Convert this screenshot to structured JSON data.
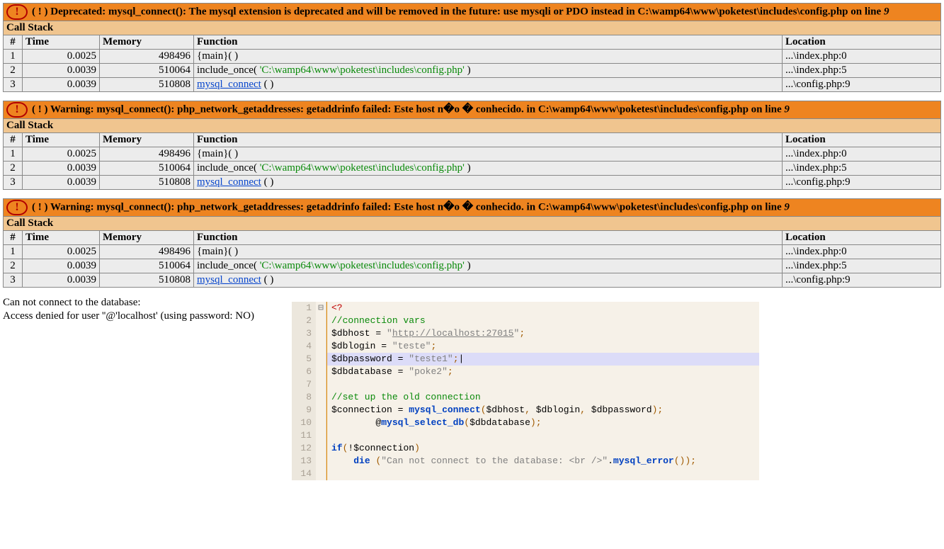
{
  "columns": {
    "idx": "#",
    "time": "Time",
    "memory": "Memory",
    "function": "Function",
    "location": "Location"
  },
  "callstack_label": "Call Stack",
  "errors": [
    {
      "kind": "Deprecated",
      "msg": "mysql_connect(): The mysql extension is deprecated and will be removed in the future: use mysqli or PDO instead in C:\\wamp64\\www\\poketest\\includes\\config.php on line",
      "line": "9",
      "stack": [
        {
          "idx": "1",
          "time": "0.0025",
          "mem": "498496",
          "func_pre": "{main}( )",
          "path": "",
          "func_post": "",
          "link": "",
          "loc": "...\\index.php:0"
        },
        {
          "idx": "2",
          "time": "0.0039",
          "mem": "510064",
          "func_pre": "include_once( ",
          "path": "'C:\\wamp64\\www\\poketest\\includes\\config.php'",
          "func_post": " )",
          "link": "",
          "loc": "...\\index.php:5"
        },
        {
          "idx": "3",
          "time": "0.0039",
          "mem": "510808",
          "func_pre": "",
          "path": "",
          "func_post": " ( )",
          "link": "mysql_connect",
          "loc": "...\\config.php:9"
        }
      ]
    },
    {
      "kind": "Warning",
      "msg": "mysql_connect(): php_network_getaddresses: getaddrinfo failed: Este host n�o � conhecido. in C:\\wamp64\\www\\poketest\\includes\\config.php on line",
      "line": "9",
      "stack": [
        {
          "idx": "1",
          "time": "0.0025",
          "mem": "498496",
          "func_pre": "{main}( )",
          "path": "",
          "func_post": "",
          "link": "",
          "loc": "...\\index.php:0"
        },
        {
          "idx": "2",
          "time": "0.0039",
          "mem": "510064",
          "func_pre": "include_once( ",
          "path": "'C:\\wamp64\\www\\poketest\\includes\\config.php'",
          "func_post": " )",
          "link": "",
          "loc": "...\\index.php:5"
        },
        {
          "idx": "3",
          "time": "0.0039",
          "mem": "510808",
          "func_pre": "",
          "path": "",
          "func_post": " ( )",
          "link": "mysql_connect",
          "loc": "...\\config.php:9"
        }
      ]
    },
    {
      "kind": "Warning",
      "msg": "mysql_connect(): php_network_getaddresses: getaddrinfo failed: Este host n�o � conhecido. in C:\\wamp64\\www\\poketest\\includes\\config.php on line",
      "line": "9",
      "stack": [
        {
          "idx": "1",
          "time": "0.0025",
          "mem": "498496",
          "func_pre": "{main}( )",
          "path": "",
          "func_post": "",
          "link": "",
          "loc": "...\\index.php:0"
        },
        {
          "idx": "2",
          "time": "0.0039",
          "mem": "510064",
          "func_pre": "include_once( ",
          "path": "'C:\\wamp64\\www\\poketest\\includes\\config.php'",
          "func_post": " )",
          "link": "",
          "loc": "...\\index.php:5"
        },
        {
          "idx": "3",
          "time": "0.0039",
          "mem": "510808",
          "func_pre": "",
          "path": "",
          "func_post": " ( )",
          "link": "mysql_connect",
          "loc": "...\\config.php:9"
        }
      ]
    }
  ],
  "plain": {
    "line1": "Can not connect to the database:",
    "line2": "Access denied for user ''@'localhost' (using password: NO)"
  },
  "editor": {
    "lines": [
      {
        "n": "1",
        "fold": "⊟",
        "hl": false,
        "html": "<span class='tok-open'>&lt;?</span>"
      },
      {
        "n": "2",
        "fold": "",
        "hl": false,
        "html": "<span class='tok-cmt'>//connection vars</span>"
      },
      {
        "n": "3",
        "fold": "",
        "hl": false,
        "html": "<span class='tok-var'>$dbhost</span> <span class='tok-op'>=</span> <span class='tok-strp'>\"</span><span class='tok-str'>http://localhost:27015</span><span class='tok-strp'>\"</span><span class='tok-punc'>;</span>"
      },
      {
        "n": "4",
        "fold": "",
        "hl": false,
        "html": "<span class='tok-var'>$dblogin</span> <span class='tok-op'>=</span> <span class='tok-strp'>\"teste\"</span><span class='tok-punc'>;</span>"
      },
      {
        "n": "5",
        "fold": "",
        "hl": true,
        "html": "<span class='tok-var'>$dbpassword</span> <span class='tok-op'>=</span> <span class='tok-strp'>\"teste1\"</span><span class='tok-punc'>;</span>|"
      },
      {
        "n": "6",
        "fold": "",
        "hl": false,
        "html": "<span class='tok-var'>$dbdatabase</span> <span class='tok-op'>=</span> <span class='tok-strp'>\"poke2\"</span><span class='tok-punc'>;</span>"
      },
      {
        "n": "7",
        "fold": "",
        "hl": false,
        "html": " "
      },
      {
        "n": "8",
        "fold": "",
        "hl": false,
        "html": "<span class='tok-cmt'>//set up the old connection</span>"
      },
      {
        "n": "9",
        "fold": "",
        "hl": false,
        "html": "<span class='tok-var'>$connection</span> <span class='tok-op'>=</span> <span class='tok-kw'>mysql_connect</span><span class='tok-punc'>(</span><span class='tok-var'>$dbhost</span><span class='tok-punc'>,</span> <span class='tok-var'>$dblogin</span><span class='tok-punc'>,</span> <span class='tok-var'>$dbpassword</span><span class='tok-punc'>)</span><span class='tok-punc'>;</span>"
      },
      {
        "n": "10",
        "fold": "",
        "hl": false,
        "html": "        <span class='tok-op'>@</span><span class='tok-kw'>mysql_select_db</span><span class='tok-punc'>(</span><span class='tok-var'>$dbdatabase</span><span class='tok-punc'>)</span><span class='tok-punc'>;</span>"
      },
      {
        "n": "11",
        "fold": "",
        "hl": false,
        "html": " "
      },
      {
        "n": "12",
        "fold": "",
        "hl": false,
        "html": "<span class='tok-kw'>if</span><span class='tok-punc'>(</span><span class='tok-op'>!</span><span class='tok-var'>$connection</span><span class='tok-punc'>)</span>"
      },
      {
        "n": "13",
        "fold": "",
        "hl": false,
        "html": "    <span class='tok-kw'>die</span> <span class='tok-punc'>(</span><span class='tok-strp'>\"Can not connect to the database: &lt;br /&gt;\"</span><span class='tok-op'>.</span><span class='tok-kw'>mysql_error</span><span class='tok-punc'>()</span><span class='tok-punc'>)</span><span class='tok-punc'>;</span>"
      },
      {
        "n": "14",
        "fold": "",
        "hl": false,
        "html": " "
      }
    ]
  }
}
